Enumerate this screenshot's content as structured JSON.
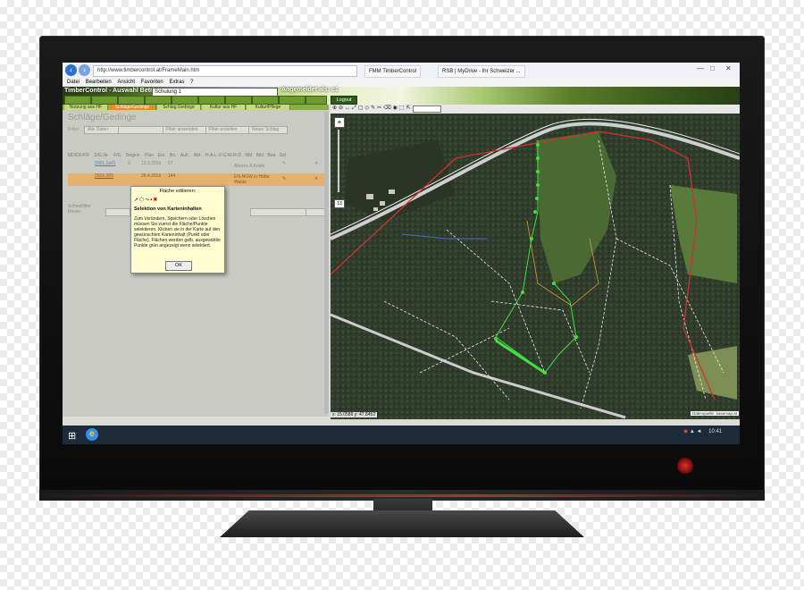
{
  "browser": {
    "url": "http://www.timbercontrol.at/FrameMain.htm",
    "tabs": [
      "FMM TimberControl",
      "RSB | MyDrive - Ihr Schweizer ..."
    ],
    "menu": [
      "Datei",
      "Bearbeiten",
      "Ansicht",
      "Favoriten",
      "Extras",
      "?"
    ]
  },
  "app": {
    "title": "TimberControl - Auswahl Betrieb",
    "betrieb_value": "Schulung 1",
    "user_label": "Angemeldet als: c1",
    "logout_label": "Logout",
    "subtabs": [
      "Nutzung aus HF",
      "Schläge/Gedinge",
      "Schlag Gedinge",
      "Kultur aus HF",
      "Kultur/Pflege"
    ]
  },
  "left_panel": {
    "title": "Schläge/Gedinge",
    "filter_label": "Filter:",
    "filter_value": "Alle Daten",
    "filter_apply": "Filter anwenden",
    "filter_create": "Filter erstellen",
    "new_schlag": "Neuer Schlag",
    "table_headers": [
      "MD/DF/FR",
      "S/G-Nr.",
      "F/G",
      "Beginn",
      "Plan",
      "Ern.",
      "Bri.",
      "Aufr.",
      "Abf.",
      "H-A-L-V-G-W-R-D",
      "NM",
      "Bild",
      "Bea",
      "Del"
    ],
    "rows": [
      {
        "id": "2001.1a01",
        "fg": "S",
        "date": "13.3.2016",
        "plan": "57",
        "owner": "Ahrens A.Kniek"
      },
      {
        "id": "2016.265",
        "fg": "",
        "date": "26.4.2016",
        "plan": "144",
        "owner": "EN-NGW in Hütte Walde"
      }
    ],
    "schnellfilter_label": "Schnellfilter Revier"
  },
  "dialog": {
    "title": "Fläche editieren:",
    "heading": "Selektion von Karteninhalten",
    "body": "Zum Verändern, Speichern oder Löschen müssen Sie zuerst die Fläche/Punkte selektieren. Klicken sie in der Karte auf den gewünschten Karteninhalt (Punkt oder Fläche). Flächen werden gelb, ausgewählte Punkte grün angezeigt wenn selektiert.",
    "ok": "OK"
  },
  "map": {
    "zoom_level": "13",
    "coordinates": "x: 15.0586 y: 47.8452",
    "source": "Datenquelle: basemap.at"
  },
  "taskbar": {
    "clock": "10:41"
  },
  "colors": {
    "tab_green": "#6e9b2e",
    "active_orange": "#e88a1d",
    "selection_green": "#3fe03f",
    "boundary_red": "#d23030"
  }
}
